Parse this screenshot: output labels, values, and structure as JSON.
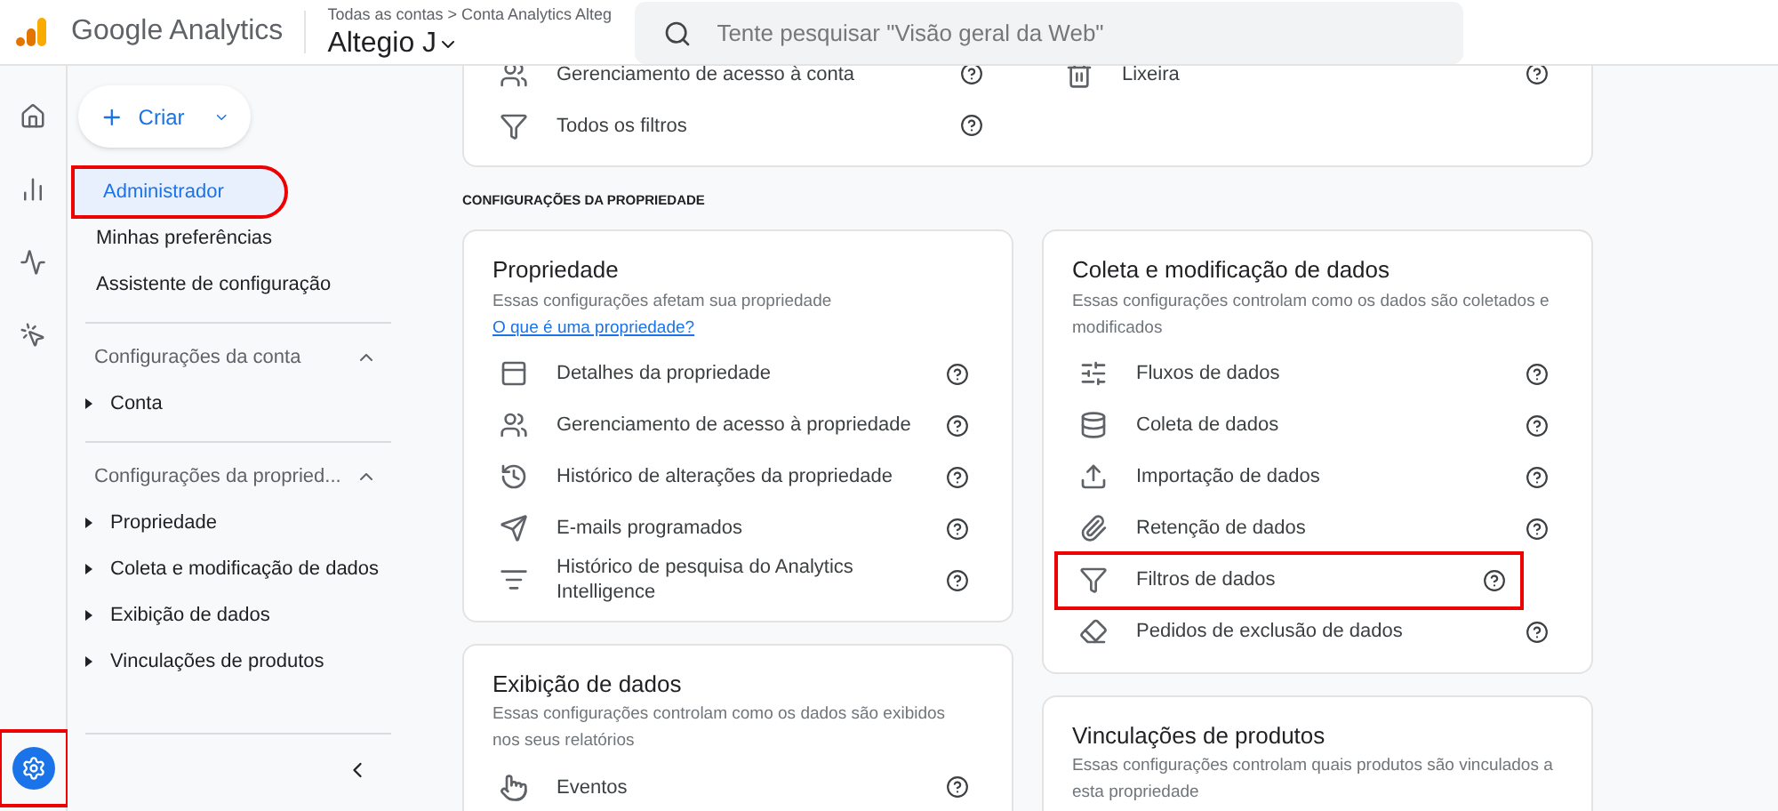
{
  "header": {
    "product": "Google Analytics",
    "breadcrumb": "Todas as contas > Conta Analytics Alteg",
    "account": "Altegio J",
    "search": {
      "placeholder": "Tente pesquisar \"Visão geral da Web\""
    }
  },
  "rail": [
    {
      "selected": false,
      "highlighted": false
    },
    {
      "selected": false,
      "highlighted": false
    },
    {
      "selected": false,
      "highlighted": false
    },
    {
      "selected": false,
      "highlighted": false
    }
  ],
  "admin_button": {
    "selected": true,
    "highlighted": true
  },
  "create_button": "Criar",
  "sidebar": {
    "items": [
      {
        "label": "Administrador",
        "selected": true,
        "highlighted": true
      },
      {
        "label": "Minhas preferências",
        "selected": false,
        "highlighted": false
      },
      {
        "label": "Assistente de configuração",
        "selected": false,
        "highlighted": false
      }
    ],
    "groups": [
      {
        "title": "Configurações da conta",
        "expanded": true,
        "items": [
          "Conta"
        ]
      },
      {
        "title": "Configurações da propried...",
        "expanded": true,
        "items": [
          "Propriedade",
          "Coleta e modificação de dados",
          "Exibição de dados",
          "Vinculações de produtos"
        ]
      }
    ]
  },
  "account_card": {
    "left": [
      "Gerenciamento de acesso à conta",
      "Todos os filtros"
    ],
    "right": [
      "Lixeira"
    ]
  },
  "section_title": "CONFIGURAÇÕES DA PROPRIEDADE",
  "columns": [
    [
      {
        "title": "Propriedade",
        "description": "Essas configurações afetam sua propriedade ",
        "link": "O que é uma propriedade?",
        "items": [
          {
            "label": "Detalhes da propriedade",
            "highlighted": false
          },
          {
            "label": "Gerenciamento de acesso à propriedade",
            "highlighted": false
          },
          {
            "label": "Histórico de alterações da propriedade",
            "highlighted": false
          },
          {
            "label": "E-mails programados",
            "highlighted": false
          },
          {
            "label": "Histórico de pesquisa do Analytics Intelligence",
            "highlighted": false
          }
        ]
      },
      {
        "title": "Exibição de dados",
        "description": "Essas configurações controlam como os dados são exibidos nos seus relatórios",
        "items": [
          {
            "label": "Eventos",
            "highlighted": false
          }
        ]
      }
    ],
    [
      {
        "title": "Coleta e modificação de dados",
        "description": "Essas configurações controlam como os dados são coletados e modificados",
        "items": [
          {
            "label": "Fluxos de dados",
            "highlighted": false
          },
          {
            "label": "Coleta de dados",
            "highlighted": false
          },
          {
            "label": "Importação de dados",
            "highlighted": false
          },
          {
            "label": "Retenção de dados",
            "highlighted": false
          },
          {
            "label": "Filtros de dados",
            "highlighted": true
          },
          {
            "label": "Pedidos de exclusão de dados",
            "highlighted": false
          }
        ]
      },
      {
        "title": "Vinculações de produtos",
        "description": "Essas configurações controlam quais produtos são vinculados a esta propriedade"
      }
    ]
  ]
}
